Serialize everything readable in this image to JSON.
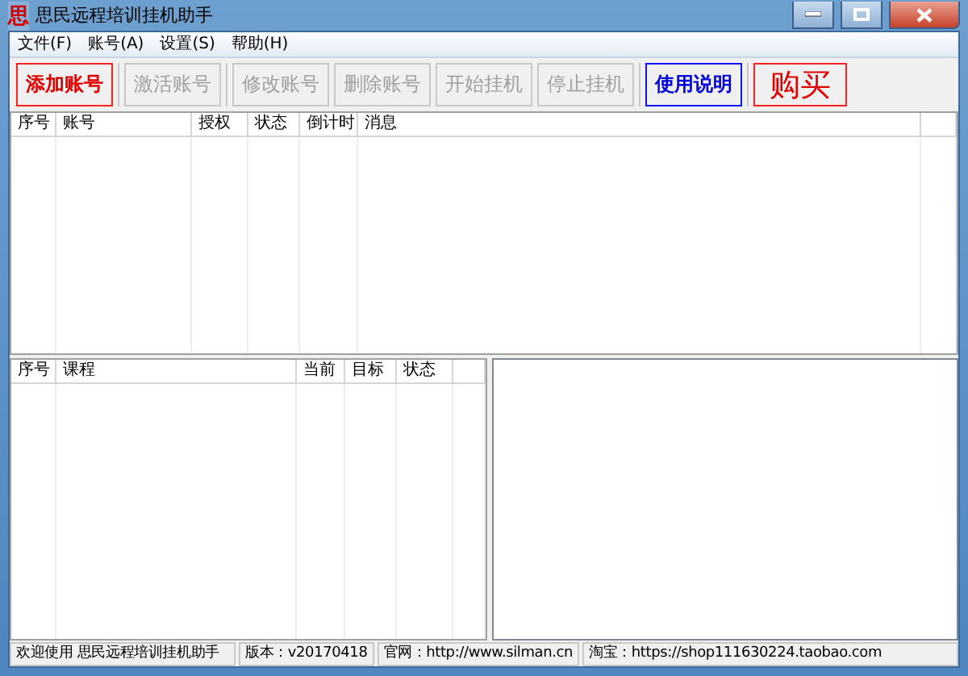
{
  "window": {
    "title": "思民远程培训挂机助手",
    "icon": "思"
  },
  "menu": [
    "文件(F)",
    "账号(A)",
    "设置(S)",
    "帮助(H)"
  ],
  "toolbar": [
    {
      "label": "添加账号",
      "kind": "accent",
      "disabled": false
    },
    {
      "label": "激活账号",
      "kind": "plain",
      "disabled": true
    },
    {
      "label": "修改账号",
      "kind": "plain",
      "disabled": true
    },
    {
      "label": "删除账号",
      "kind": "plain",
      "disabled": true
    },
    {
      "label": "开始挂机",
      "kind": "plain",
      "disabled": true
    },
    {
      "label": "停止挂机",
      "kind": "plain",
      "disabled": true
    },
    {
      "label": "使用说明",
      "kind": "info",
      "disabled": false
    },
    {
      "label": "购买",
      "kind": "buy",
      "disabled": false
    }
  ],
  "accounts_table": {
    "columns": [
      "序号",
      "账号",
      "授权",
      "状态",
      "倒计时",
      "消息"
    ]
  },
  "courses_table": {
    "columns": [
      "序号",
      "课程",
      "当前",
      "目标",
      "状态"
    ]
  },
  "status_bar": [
    "欢迎使用 思民远程培训挂机助手",
    "版本：v20170418",
    "官网：http://www.silman.cn",
    "淘宝：https://shop111630224.taobao.com"
  ]
}
